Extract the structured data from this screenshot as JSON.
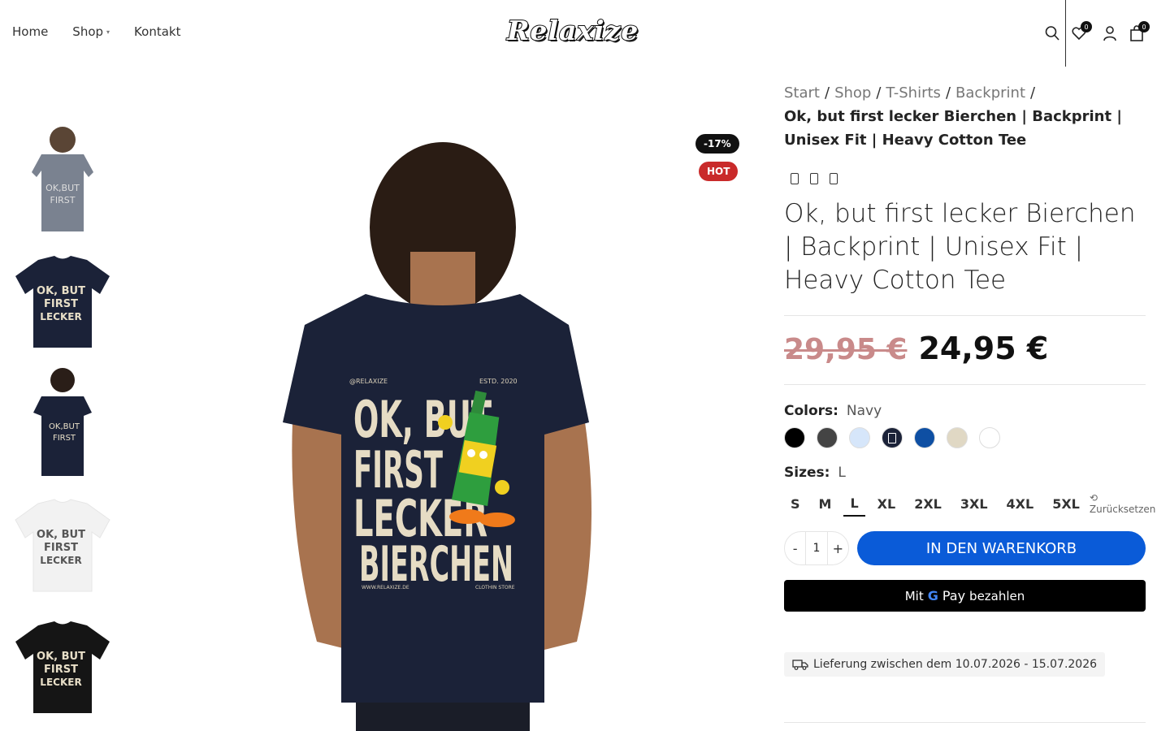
{
  "header": {
    "nav": [
      {
        "label": "Home"
      },
      {
        "label": "Shop"
      },
      {
        "label": "Kontakt"
      }
    ],
    "logo": "Relaxize",
    "wishlist_count": "0",
    "cart_count": "0",
    "icons": [
      "search-icon",
      "wishlist-icon",
      "user-icon",
      "cart-icon"
    ]
  },
  "badges": {
    "sale": "-17%",
    "hot": "HOT"
  },
  "breadcrumb": {
    "items": [
      "Start",
      "Shop",
      "T-Shirts",
      "Backprint"
    ],
    "current": "Ok, but first lecker Bierchen | Backprint | Unisex Fit | Heavy Cotton Tee"
  },
  "product": {
    "title": "Ok, but first lecker Bierchen | Backprint | Unisex Fit | Heavy Cotton Tee",
    "price_old": "29,95 €",
    "price_new": "24,95 €",
    "print_text": [
      "OK, BUT",
      "FIRST",
      "LECKER",
      "BIERCHEN"
    ],
    "print_small": {
      "top_left": "@RELAXIZE",
      "top_right": "ESTD. 2020",
      "bottom_left": "WWW.RELAXIZE.DE",
      "bottom_right": "CLOTHIN STORE"
    }
  },
  "colors": {
    "label": "Colors",
    "selected": "Navy",
    "swatches": [
      "#000000",
      "#444444",
      "#d6e6fa",
      "#1b2238",
      "#0e4fa3",
      "#e0d8c4",
      "#ffffff"
    ],
    "selected_index": 3
  },
  "sizes": {
    "label": "Sizes",
    "selected": "L",
    "options": [
      "S",
      "M",
      "L",
      "XL",
      "2XL",
      "3XL",
      "4XL",
      "5XL"
    ],
    "reset": "Zurücksetzen"
  },
  "cart": {
    "qty": "1",
    "minus": "-",
    "plus": "+",
    "button": "IN DEN WARENKORB"
  },
  "gpay": {
    "prefix": "Mit",
    "g": "G",
    "pay": "Pay",
    "suffix": "bezahlen"
  },
  "delivery": "Lieferung zwischen dem 10.07.2026 - 15.07.2026",
  "thumb_colors": [
    "#7a8290",
    "#1b2238",
    "#1b2238",
    "#f2f2f2",
    "#151515"
  ]
}
